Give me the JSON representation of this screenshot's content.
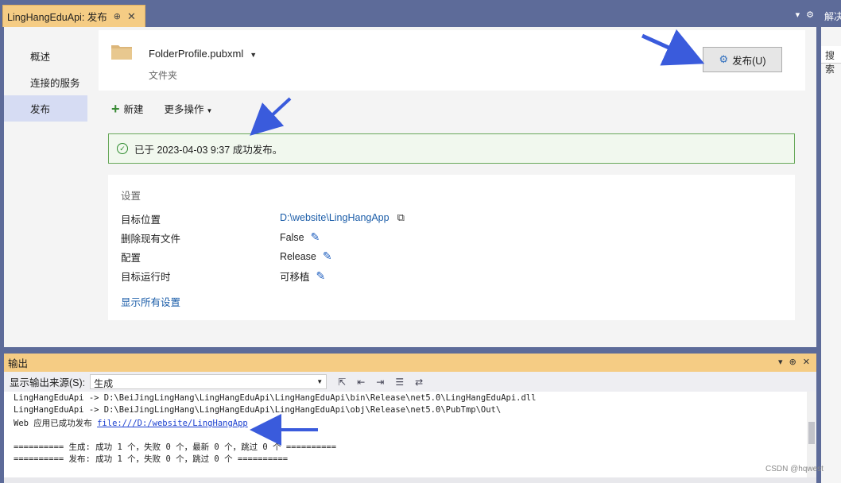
{
  "tab": {
    "title": "LingHangEduApi: 发布",
    "pin": "⊕",
    "close": "✕"
  },
  "side": {
    "header": "解决",
    "search": "搜索"
  },
  "nav": {
    "items": [
      {
        "label": "概述"
      },
      {
        "label": "连接的服务"
      },
      {
        "label": "发布"
      }
    ]
  },
  "profile": {
    "name": "FolderProfile.pubxml",
    "type": "文件夹",
    "publish_label": "发布(U)"
  },
  "actions": {
    "new_label": "新建",
    "more_label": "更多操作"
  },
  "status": {
    "message": "已于 2023-04-03 9:37 成功发布。"
  },
  "settings": {
    "title": "设置",
    "rows": [
      {
        "label": "目标位置",
        "value": "D:\\website\\LingHangApp"
      },
      {
        "label": "删除现有文件",
        "value": "False"
      },
      {
        "label": "配置",
        "value": "Release"
      },
      {
        "label": "目标运行时",
        "value": "可移植"
      }
    ],
    "show_all": "显示所有设置"
  },
  "output": {
    "title": "输出",
    "source_label": "显示输出来源(S):",
    "source_value": "生成",
    "lines": [
      "LingHangEduApi -> D:\\BeiJingLingHang\\LingHangEduApi\\LingHangEduApi\\bin\\Release\\net5.0\\LingHangEduApi.dll",
      "LingHangEduApi -> D:\\BeiJingLingHang\\LingHangEduApi\\LingHangEduApi\\obj\\Release\\net5.0\\PubTmp\\Out\\",
      "Web 应用已成功发布 ",
      "",
      "========== 生成: 成功 1 个，失败 0 个，最新 0 个，跳过 0 个 ==========",
      "========== 发布: 成功 1 个，失败 0 个，跳过 0 个 =========="
    ],
    "link": "file:///D:/website/LingHangApp"
  },
  "watermark": "CSDN @hqwest",
  "colors": {
    "tab": "#f5cc84",
    "chrome": "#5d6b99",
    "success_border": "#68a85a",
    "link": "#1a5ca8",
    "annotation_arrow": "#3a5bdc"
  }
}
